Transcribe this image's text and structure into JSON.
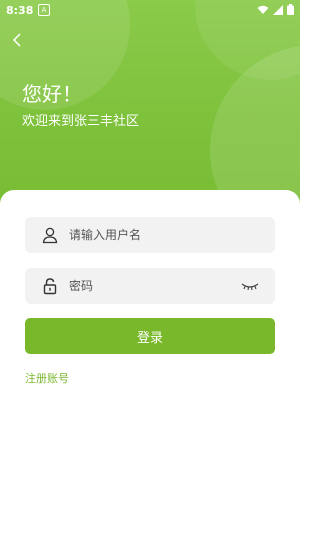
{
  "status_bar": {
    "time": "8:38",
    "notification_icon": "A"
  },
  "header": {
    "greeting": "您好！",
    "welcome": "欢迎来到张三丰社区"
  },
  "form": {
    "username_placeholder": "请输入用户名",
    "password_placeholder": "密码",
    "login_label": "登录",
    "register_label": "注册账号"
  },
  "colors": {
    "header_green": "#7EC13B",
    "button_green": "#78B82A",
    "link_green": "#7CB733",
    "input_bg": "#F2F2F2"
  },
  "icons": {
    "back": "chevron-left-icon",
    "user": "user-icon",
    "lock": "lock-icon",
    "eye": "eye-closed-icon"
  }
}
